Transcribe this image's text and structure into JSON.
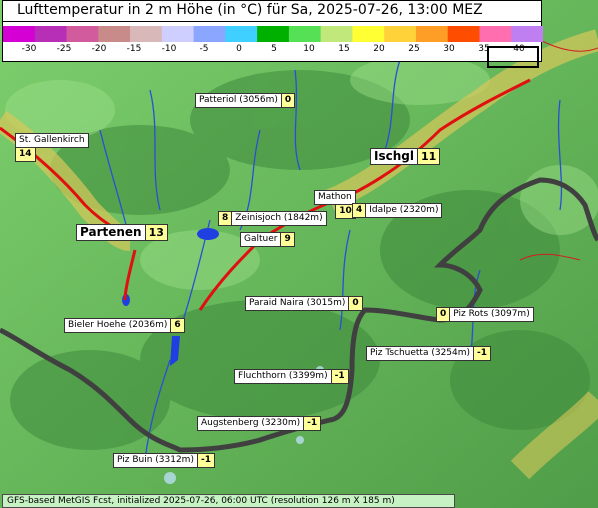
{
  "title": "Lufttemperatur in 2 m Höhe (in °C) für Sa, 2025-07-26, 13:00 MEZ",
  "legend": {
    "ticks": [
      "-30",
      "-25",
      "-20",
      "-15",
      "-10",
      "-5",
      "0",
      "5",
      "10",
      "15",
      "20",
      "25",
      "30",
      "35",
      "40"
    ],
    "colors": [
      "#d400d4",
      "#b62fb6",
      "#d15b9c",
      "#c98a8a",
      "#d8b8b8",
      "#cfcfff",
      "#8aa6ff",
      "#3fd0ff",
      "#00b000",
      "#56e056",
      "#c0e87a",
      "#ffff33",
      "#ffd23a",
      "#ff9e26",
      "#ff4d00",
      "#ff6fb0",
      "#c07ff0"
    ]
  },
  "stations": [
    {
      "name": "Patteriol (3056m)",
      "value": "0"
    },
    {
      "name": "St. Gallenkirch",
      "value": "14"
    },
    {
      "name": "Ischgl",
      "value": "11"
    },
    {
      "name": "Mathon",
      "value": "10"
    },
    {
      "name": "Idalpe (2320m)",
      "value": "4"
    },
    {
      "name": "Zeinisjoch (1842m)",
      "value": "8"
    },
    {
      "name": "Partenen",
      "value": "13"
    },
    {
      "name": "Galtuer",
      "value": "9"
    },
    {
      "name": "Paraid Naira (3015m)",
      "value": "0"
    },
    {
      "name": "Piz Rots (3097m)",
      "value": "0"
    },
    {
      "name": "Bieler Hoehe (2036m)",
      "value": "6"
    },
    {
      "name": "Piz Tschuetta (3254m)",
      "value": "-1"
    },
    {
      "name": "Fluchthorn (3399m)",
      "value": "-1"
    },
    {
      "name": "Augstenberg (3230m)",
      "value": "-1"
    },
    {
      "name": "Piz Buin (3312m)",
      "value": "-1"
    }
  ],
  "footer": "GFS-based MetGIS Fcst, initialized 2025-07-26, 06:00 UTC  (resolution 126 m X 185 m)"
}
